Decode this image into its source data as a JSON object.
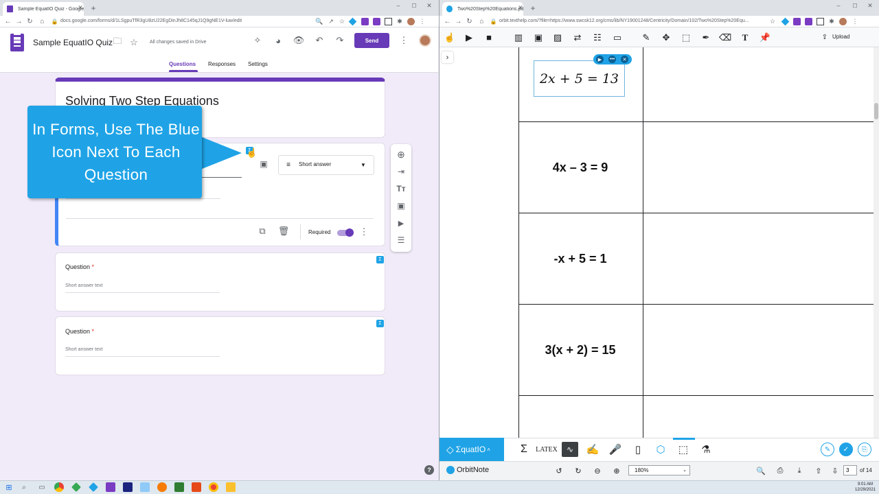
{
  "left_browser": {
    "tab_title": "Sample EquatIO Quiz - Google F",
    "url": "docs.google.com/forms/d/1LSgpuTfR3gU8zU22EgDinJh8C145qJ1Q9gNE1V-luw/edit"
  },
  "forms": {
    "doc_title": "Sample EquatIO Quiz",
    "saved_status": "All changes saved in Drive",
    "send_label": "Send",
    "tabs": [
      "Questions",
      "Responses",
      "Settings"
    ],
    "form_title": "Solving Two Step Equations",
    "active_question": {
      "type_label": "Short answer",
      "required_label": "Required",
      "required_on": true
    },
    "questions": [
      {
        "label": "Question",
        "required_mark": "*",
        "placeholder": "Short answer text"
      },
      {
        "label": "Question",
        "required_mark": "*",
        "placeholder": "Short answer text"
      }
    ],
    "callout_text": "In Forms, Use The Blue Icon Next To Each Question",
    "help": "?"
  },
  "right_browser": {
    "tab_title": "Two%20Step%20Equations.pdf",
    "url": "orbit.texthelp.com/?file=https://www.swcsk12.org/cms/lib/NY19001248/Centricity/Domain/102/Two%20Step%20Equ..."
  },
  "pdf": {
    "math_selected": "2x + 5 = 13",
    "equations": [
      "4x – 3 = 9",
      "-x + 5 = 1",
      "3(x + 2) = 15"
    ],
    "upload_label": "Upload"
  },
  "equatio": {
    "brand": "ΣquatIO",
    "latex_label": "LATEX"
  },
  "orbit": {
    "brand": "OrbitNote",
    "zoom": "180%",
    "page": "3",
    "page_of": "of 14"
  },
  "taskbar": {
    "time": "9:01 AM",
    "date": "12/29/2021"
  }
}
